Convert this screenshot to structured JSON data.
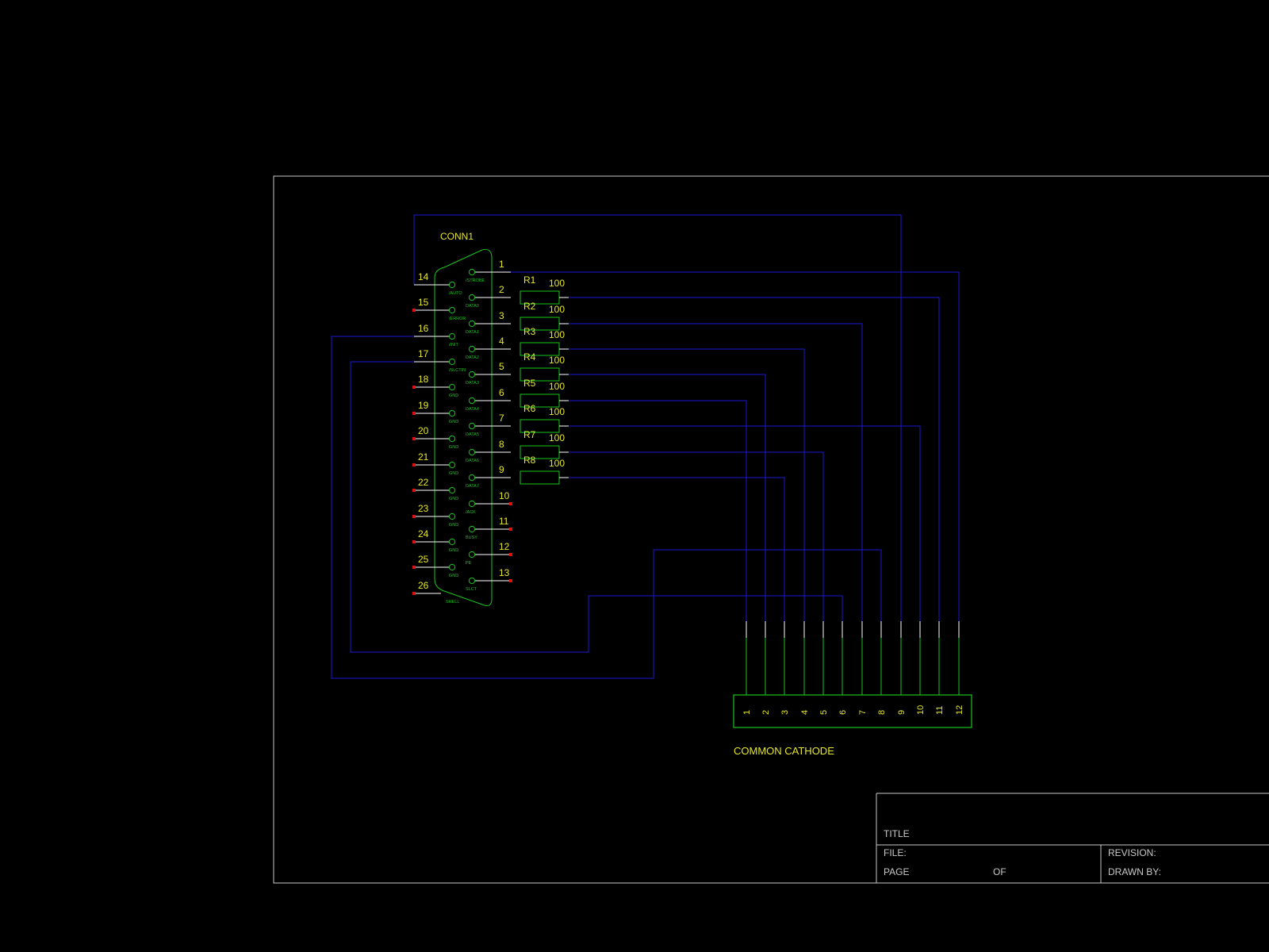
{
  "connector": {
    "ref": "CONN1",
    "right_pins": [
      {
        "num": "1",
        "signal": "/STROBE"
      },
      {
        "num": "2",
        "signal": "DATA0"
      },
      {
        "num": "3",
        "signal": "DATA1"
      },
      {
        "num": "4",
        "signal": "DATA2"
      },
      {
        "num": "5",
        "signal": "DATA3"
      },
      {
        "num": "6",
        "signal": "DATA4"
      },
      {
        "num": "7",
        "signal": "DATA5"
      },
      {
        "num": "8",
        "signal": "DATA6"
      },
      {
        "num": "9",
        "signal": "DATA7"
      },
      {
        "num": "10",
        "signal": "/ACK"
      },
      {
        "num": "11",
        "signal": "BUSY"
      },
      {
        "num": "12",
        "signal": "PE"
      },
      {
        "num": "13",
        "signal": "SLCT"
      }
    ],
    "left_pins": [
      {
        "num": "14",
        "signal": "/AUTO"
      },
      {
        "num": "15",
        "signal": "/ERROR"
      },
      {
        "num": "16",
        "signal": "/INIT"
      },
      {
        "num": "17",
        "signal": "/SLCTIN"
      },
      {
        "num": "18",
        "signal": "GND"
      },
      {
        "num": "19",
        "signal": "GND"
      },
      {
        "num": "20",
        "signal": "GND"
      },
      {
        "num": "21",
        "signal": "GND"
      },
      {
        "num": "22",
        "signal": "GND"
      },
      {
        "num": "23",
        "signal": "GND"
      },
      {
        "num": "24",
        "signal": "GND"
      },
      {
        "num": "25",
        "signal": "GND"
      },
      {
        "num": "26",
        "signal": "SHELL"
      }
    ]
  },
  "resistors": [
    {
      "ref": "R1",
      "value": "100"
    },
    {
      "ref": "R2",
      "value": "100"
    },
    {
      "ref": "R3",
      "value": "100"
    },
    {
      "ref": "R4",
      "value": "100"
    },
    {
      "ref": "R5",
      "value": "100"
    },
    {
      "ref": "R6",
      "value": "100"
    },
    {
      "ref": "R7",
      "value": "100"
    },
    {
      "ref": "R8",
      "value": "100"
    }
  ],
  "display": {
    "label": "COMMON CATHODE",
    "pins": [
      "1",
      "2",
      "3",
      "4",
      "5",
      "6",
      "7",
      "8",
      "9",
      "10",
      "11",
      "12"
    ]
  },
  "title_block": {
    "title": "TITLE",
    "file": "FILE:",
    "revision": "REVISION:",
    "page": "PAGE",
    "of": "OF",
    "drawn_by": "DRAWN BY:"
  },
  "colors": {
    "background": "#000000",
    "wire": "#1a1ad2",
    "component": "#19c31c",
    "label": "#e6e62e",
    "pin": "#ffffff",
    "nc_marker": "#e01010",
    "frame": "#c8c8c8"
  }
}
